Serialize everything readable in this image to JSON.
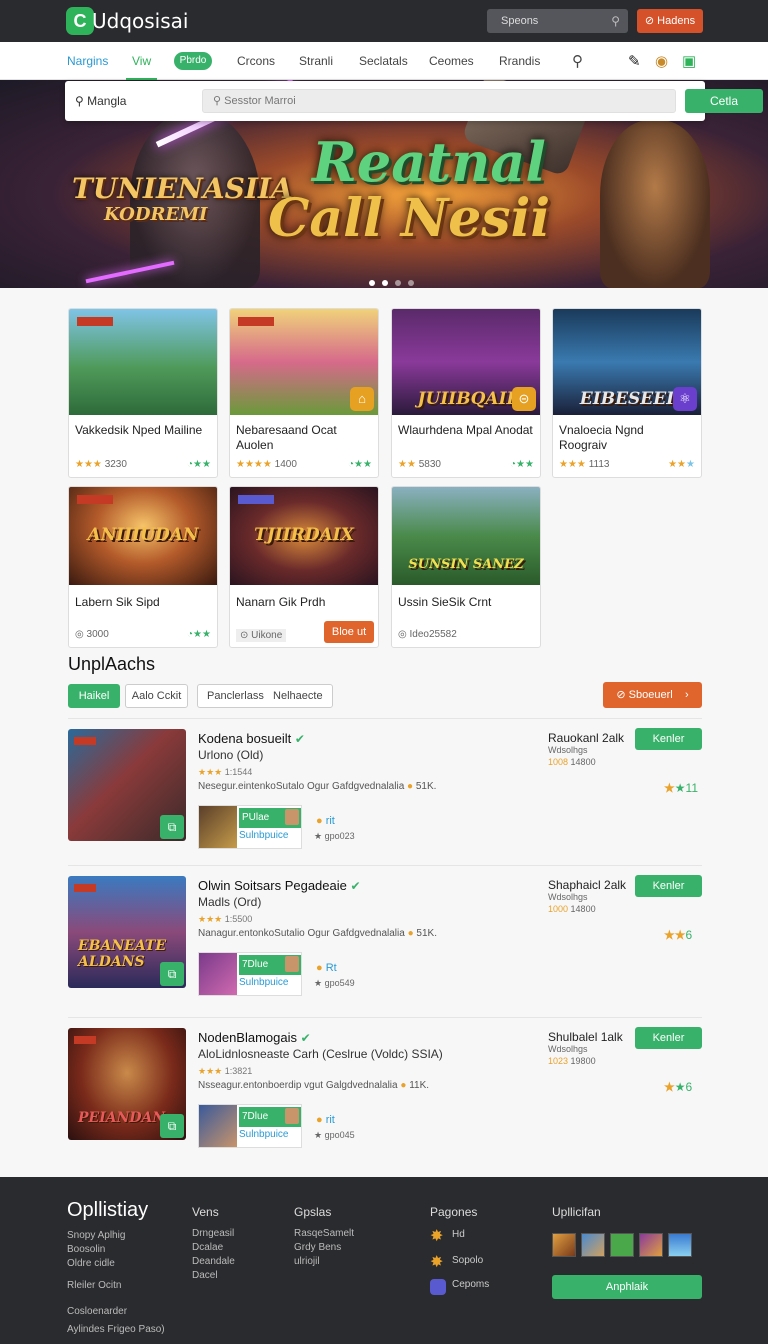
{
  "header": {
    "brand": "Udqosisai",
    "search_placeholder": "Speons",
    "action_label": "Hadens"
  },
  "nav": {
    "items": [
      "Nargins",
      "Viw",
      "Pbrdo",
      "Crcons",
      "Stranli",
      "Seclatals",
      "Ceomes",
      "Rrandis"
    ]
  },
  "search_bar": {
    "label": "Mangla",
    "placeholder": "Sesstor Marroi",
    "button": "Cetla"
  },
  "hero": {
    "left_title": "TUNIENASIIA",
    "left_sub": "KODREMI",
    "main_line1": "Reatnal",
    "main_line2": "Call Nesii"
  },
  "grid": [
    {
      "name": "Vakkedsik Nped Mailine",
      "rating": "3230",
      "img_text": ""
    },
    {
      "name": "Nebaresaand Ocat Auolen",
      "rating": "1400",
      "img_text": ""
    },
    {
      "name": "Wlaurhdena Mpal Anodat",
      "rating": "5830",
      "img_text": "JUIIBQAII"
    },
    {
      "name": "Vnaloecia Ngnd Roograiv",
      "rating": "1113",
      "img_text": "EIBESEEI"
    },
    {
      "name": "Labern Sik Sipd",
      "rating": "3000",
      "img_text": "ANIIIUDAN"
    },
    {
      "name": "Nanarn Gik Prdh",
      "rating": "Uikone",
      "img_text": "TJIIRDAIX",
      "button": "Bloe ut"
    },
    {
      "name": "Ussin SieSik Crnt",
      "rating": "Ideo25582",
      "img_text": "SUNSIN SANEZ"
    }
  ],
  "section": {
    "title": "UnplAachs",
    "filters": [
      "Haikel",
      "Aalo Cckit",
      "Panclerlass",
      "Nelhaecte"
    ],
    "sort": "Sboeuerl"
  },
  "list": [
    {
      "title": "Kodena bosueilt",
      "subtitle": "Urlono (Old)",
      "stars": "1:1544",
      "desc": "Nesegur.eintenkoSutalo Ogur Gafdgvednalalia",
      "desc_count": "51K.",
      "mini_title": "PUlae",
      "mini_sub": "Sulnbpuice",
      "check": "rit",
      "count": "gpo023",
      "right_title": "Rauokanl 2alk",
      "right_sub": "Wdsolhgs",
      "right_price": "1008",
      "right_num": "14800",
      "button": "Kenler",
      "rating": "11",
      "thumb_text": ""
    },
    {
      "title": "Olwin Soitsars Pegadeaie",
      "subtitle": "Madls (Ord)",
      "stars": "1:5500",
      "desc": "Nanagur.entonkoSutalio Ogur Gafdgvednalalia",
      "desc_count": "51K.",
      "mini_title": "7Dlue",
      "mini_sub": "Sulnbpuice",
      "check": "Rt",
      "count": "gpo549",
      "right_title": "Shaphaicl 2alk",
      "right_sub": "Wdsolhgs",
      "right_price": "1000",
      "right_num": "14800",
      "button": "Kenler",
      "rating": "6",
      "thumb_text": "EBANEATE ALDANS"
    },
    {
      "title": "NodenBlamogais",
      "subtitle": "AloLidnlosneaste Carh (Ceslrue (Voldc) SSIA)",
      "stars": "1:3821",
      "desc": "Nsseagur.entonboerdip vgut Galgdvednalalia",
      "desc_count": "11K.",
      "mini_title": "7Dlue",
      "mini_sub": "Sulnbpuice",
      "check": "rit",
      "count": "gpo045",
      "right_title": "Shulbalel 1alk",
      "right_sub": "Wdsolhgs",
      "right_price": "1023",
      "right_num": "19800",
      "button": "Kenler",
      "rating": "6",
      "thumb_text": "PEIANDAN"
    }
  ],
  "footer": {
    "brand": "Opllistiay",
    "col1": [
      "Snopy Aplhig",
      "Boosolin",
      "Oldre cidle",
      "",
      "Rleiler Ocitn",
      "",
      "Cosloenarder",
      "Aylindes Frigeo Paso)"
    ],
    "col2_head": "Vens",
    "col2": [
      "Drngeasil",
      "Dcalae",
      "Deandale",
      "Dacel"
    ],
    "col3_head": "Gpslas",
    "col3": [
      "RasqeSamelt",
      "Grdy Bens",
      "ulriojil"
    ],
    "col4_head": "Pagones",
    "col4": [
      "Hd",
      "Sopolo",
      "Cepoms"
    ],
    "col5_head": "Upllicifan",
    "button": "Anphlaik"
  }
}
